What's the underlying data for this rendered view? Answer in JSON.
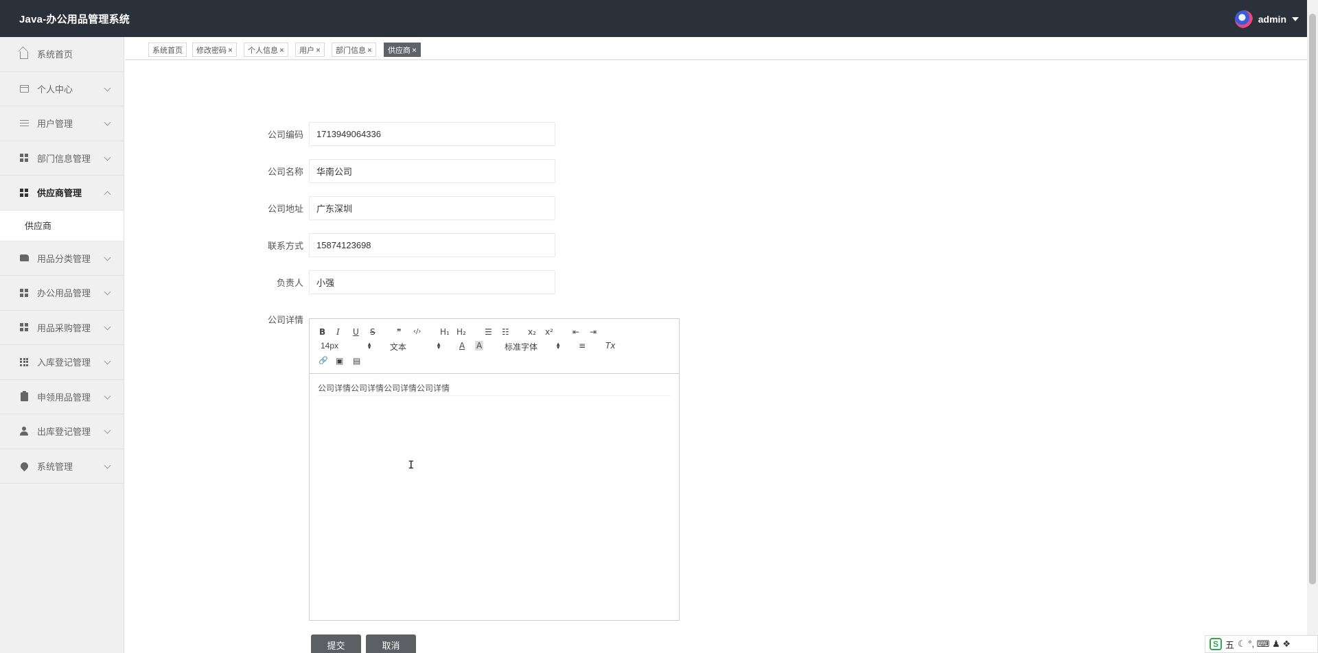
{
  "header": {
    "app_title": "Java-办公用品管理系统",
    "username": "admin"
  },
  "sidebar": {
    "items": [
      {
        "label": "系统首页",
        "icon": "home-icon"
      },
      {
        "label": "个人中心",
        "icon": "card-icon"
      },
      {
        "label": "用户管理",
        "icon": "sliders-icon"
      },
      {
        "label": "部门信息管理",
        "icon": "grid-icon"
      },
      {
        "label": "供应商管理",
        "icon": "grid-icon",
        "expanded": true
      },
      {
        "label": "用品分类管理",
        "icon": "hand-icon"
      },
      {
        "label": "办公用品管理",
        "icon": "grid-icon"
      },
      {
        "label": "用品采购管理",
        "icon": "grid-icon"
      },
      {
        "label": "入库登记管理",
        "icon": "grid9-icon"
      },
      {
        "label": "申领用品管理",
        "icon": "clipboard-icon"
      },
      {
        "label": "出库登记管理",
        "icon": "user-icon"
      },
      {
        "label": "系统管理",
        "icon": "pin-icon"
      }
    ],
    "submenu": {
      "label": "供应商"
    }
  },
  "tabs": [
    {
      "label": "系统首页",
      "closable": false
    },
    {
      "label": "修改密码",
      "closable": true
    },
    {
      "label": "个人信息",
      "closable": true
    },
    {
      "label": "用户",
      "closable": true
    },
    {
      "label": "部门信息",
      "closable": true
    },
    {
      "label": "供应商",
      "closable": true,
      "active": true
    }
  ],
  "tab_close_glyph": "×",
  "form": {
    "company_code": {
      "label": "公司编码",
      "value": "1713949064336"
    },
    "company_name": {
      "label": "公司名称",
      "value": "华南公司"
    },
    "company_address": {
      "label": "公司地址",
      "value": "广东深圳"
    },
    "contact": {
      "label": "联系方式",
      "value": "15874123698"
    },
    "manager": {
      "label": "负责人",
      "value": "小强"
    },
    "detail": {
      "label": "公司详情",
      "value": "公司详情公司详情公司详情公司详情"
    }
  },
  "editor": {
    "toolbar": {
      "bold": "B",
      "italic": "I",
      "underline": "U",
      "strike": "S",
      "blockquote": "❞",
      "code": "‹/›",
      "h1": "H₁",
      "h2": "H₂",
      "ordered_list": "☰",
      "bullet_list": "☷",
      "subscript": "x₂",
      "superscript": "x²",
      "outdent": "⇤",
      "indent": "⇥",
      "size": "14px",
      "header": "文本",
      "font": "标准字体",
      "color": "A",
      "background": "A",
      "align": "≡",
      "clean": "Tx",
      "link": "🔗",
      "image": "▣",
      "video": "▤"
    }
  },
  "buttons": {
    "submit": "提交",
    "cancel": "取消"
  },
  "ime": {
    "logo": "S",
    "mode": "五",
    "icons": "☾ °, ⌨ ♟ ❖"
  },
  "colors": {
    "header_bg": "#2b313a",
    "sidebar_bg": "#f0f0f0",
    "active_tab": "#5f6266",
    "button": "#5c5f63"
  }
}
